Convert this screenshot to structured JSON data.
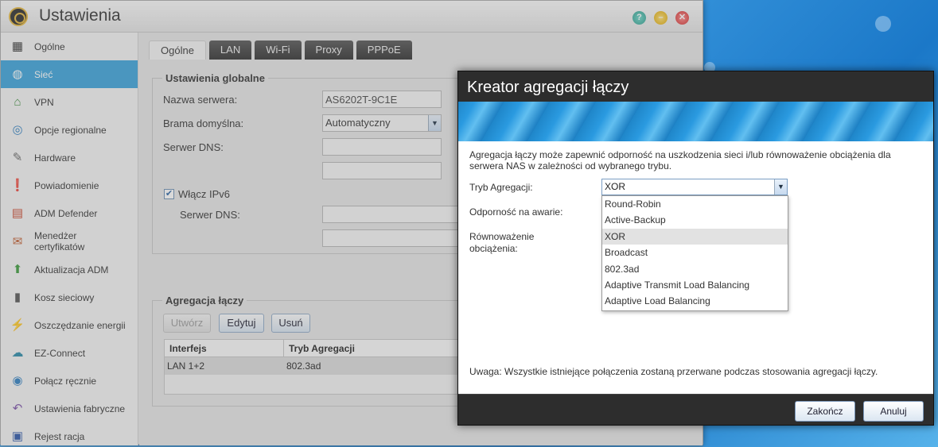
{
  "window": {
    "title": "Ustawienia"
  },
  "sidebar": {
    "items": [
      {
        "label": "Ogólne",
        "icon": "server-icon"
      },
      {
        "label": "Sieć",
        "icon": "globe-icon"
      },
      {
        "label": "VPN",
        "icon": "vpn-house-icon"
      },
      {
        "label": "Opcje regionalne",
        "icon": "globe-region-icon"
      },
      {
        "label": "Hardware",
        "icon": "wrench-icon"
      },
      {
        "label": "Powiadomienie",
        "icon": "alert-icon"
      },
      {
        "label": "ADM Defender",
        "icon": "firewall-icon"
      },
      {
        "label": "Menedżer certyfikatów",
        "icon": "certificate-icon"
      },
      {
        "label": "Aktualizacja ADM",
        "icon": "arrow-up-icon"
      },
      {
        "label": "Kosz sieciowy",
        "icon": "trash-icon"
      },
      {
        "label": "Oszczędzanie energii",
        "icon": "lightning-icon"
      },
      {
        "label": "EZ-Connect",
        "icon": "cloud-icon"
      },
      {
        "label": "Połącz ręcznie",
        "icon": "connect-icon"
      },
      {
        "label": "Ustawienia fabryczne",
        "icon": "undo-icon"
      },
      {
        "label": "Rejest racja",
        "icon": "register-icon"
      }
    ],
    "active_index": 1
  },
  "tabs": [
    "Ogólne",
    "LAN",
    "Wi-Fi",
    "Proxy",
    "PPPoE"
  ],
  "global_settings": {
    "legend": "Ustawienia globalne",
    "server_name_label": "Nazwa serwera:",
    "server_name_value": "AS6202T-9C1E",
    "gateway_label": "Brama domyślna:",
    "gateway_value": "Automatyczny",
    "dns_label": "Serwer DNS:",
    "ipv6_label": "Włącz IPv6",
    "ipv6_checked": true,
    "ipv6_dns_label": "Serwer DNS:"
  },
  "link_aggregation": {
    "legend": "Agregacja łączy",
    "create_label": "Utwórz",
    "edit_label": "Edytuj",
    "delete_label": "Usuń",
    "columns": [
      "Interfejs",
      "Tryb Agregacji"
    ],
    "rows": [
      [
        "LAN 1+2",
        "802.3ad"
      ]
    ]
  },
  "wizard": {
    "title": "Kreator agregacji łączy",
    "description": "Agregacja łączy może zapewnić odporność na uszkodzenia sieci i/lub równoważenie obciążenia dla serwera NAS w zależności od wybranego trybu.",
    "mode_label": "Tryb Agregacji:",
    "mode_value": "XOR",
    "failover_label": "Odporność na awarie:",
    "balance_label_1": "Równoważenie",
    "balance_label_2": "obciążenia:",
    "options": [
      "Round-Robin",
      "Active-Backup",
      "XOR",
      "Broadcast",
      "802.3ad",
      "Adaptive Transmit Load Balancing",
      "Adaptive Load Balancing"
    ],
    "selected_option_index": 2,
    "note": "Uwaga: Wszystkie istniejące połączenia zostaną przerwane podczas stosowania agregacji łączy.",
    "finish_label": "Zakończ",
    "cancel_label": "Anuluj"
  },
  "colors": {
    "accent": "#3aa3db",
    "dialog_dark": "#2d2d2d"
  }
}
